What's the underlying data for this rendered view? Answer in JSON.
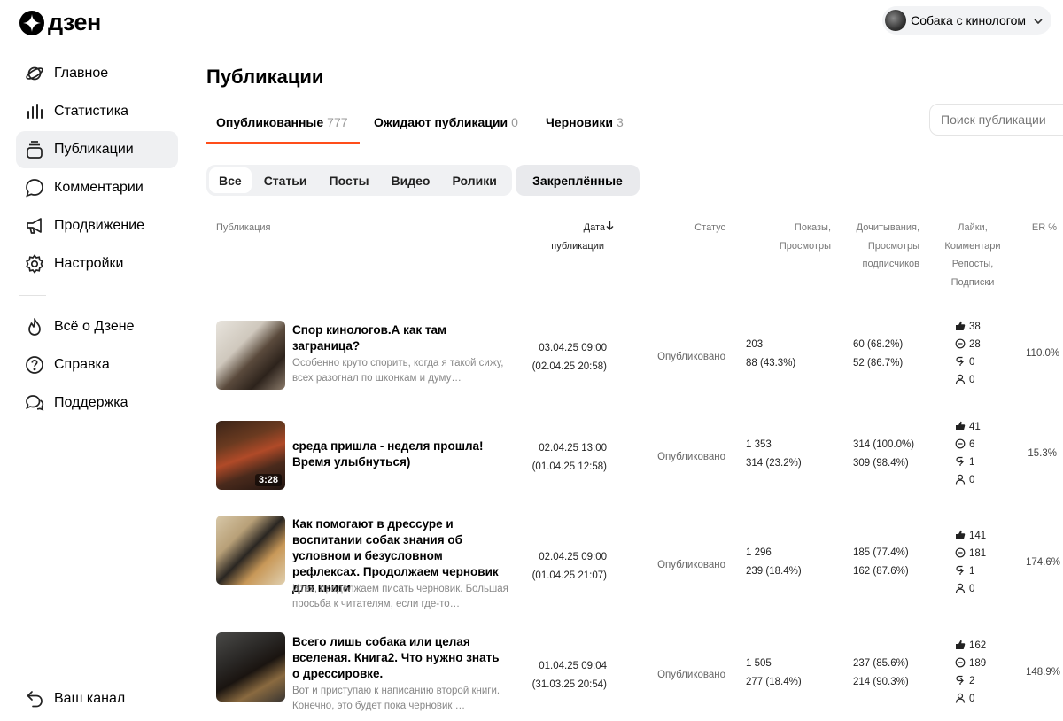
{
  "brand": {
    "name": "дзен"
  },
  "account": {
    "name": "Собака с кинологом"
  },
  "sidebar": {
    "items": [
      {
        "label": "Главное",
        "icon": "planet-icon"
      },
      {
        "label": "Статистика",
        "icon": "bar-chart-icon"
      },
      {
        "label": "Публикации",
        "icon": "publications-icon"
      },
      {
        "label": "Комментарии",
        "icon": "comment-icon"
      },
      {
        "label": "Продвижение",
        "icon": "megaphone-icon"
      },
      {
        "label": "Настройки",
        "icon": "gear-icon"
      }
    ],
    "secondary": [
      {
        "label": "Всё о Дзене",
        "icon": "flame-icon"
      },
      {
        "label": "Справка",
        "icon": "help-icon"
      },
      {
        "label": "Поддержка",
        "icon": "support-chat-icon"
      }
    ],
    "bottom": {
      "label": "Ваш канал",
      "icon": "back-arrow-icon"
    }
  },
  "page": {
    "title": "Публикации"
  },
  "tabs": [
    {
      "label": "Опубликованные",
      "count": "777"
    },
    {
      "label": "Ожидают публикации",
      "count": "0"
    },
    {
      "label": "Черновики",
      "count": "3"
    }
  ],
  "search": {
    "placeholder": "Поиск публикации"
  },
  "filters": [
    "Все",
    "Статьи",
    "Посты",
    "Видео",
    "Ролики"
  ],
  "pinned_label": "Закреплённые",
  "columns": {
    "publication": "Публикация",
    "date_1": "Дата",
    "date_2": "публикации",
    "status": "Статус",
    "shows_1": "Показы,",
    "shows_2": "Просмотры",
    "read_1": "Дочитывания,",
    "read_2": "Просмотры",
    "read_3": "подписчиков",
    "likes_1": "Лайки,",
    "likes_2": "Комментари",
    "likes_3": "Репосты,",
    "likes_4": "Подписки",
    "er": "ER %"
  },
  "rows": [
    {
      "title": "Спор кинологов.А как там заграница?",
      "desc": "Особенно круто спорить, когда я такой сижу, всех разогнал по шконкам и думу…",
      "date": "03.04.25 09:00",
      "date2": "(02.04.25 20:58)",
      "status": "Опубликовано",
      "shows": "203",
      "views": "88 (43.3%)",
      "reads": "60 (68.2%)",
      "sub_views": "52 (86.7%)",
      "likes": "38",
      "comments": "28",
      "reposts": "0",
      "subs": "0",
      "er": "110.0%",
      "duration": ""
    },
    {
      "title": "среда пришла - неделя прошла! Время улыбнуться)",
      "desc": "",
      "date": "02.04.25 13:00",
      "date2": "(01.04.25 12:58)",
      "status": "Опубликовано",
      "shows": "1 353",
      "views": "314 (23.2%)",
      "reads": "314 (100.0%)",
      "sub_views": "309 (98.4%)",
      "likes": "41",
      "comments": "6",
      "reposts": "1",
      "subs": "0",
      "er": "15.3%",
      "duration": "3:28"
    },
    {
      "title": "Как помогают в дрессуре и воспитании собак знания об условном и безусловном рефлексах. Продолжаем черновик для книги",
      "desc": "Итак, продолжаем писать черновик. Большая просьба к читателям, если где-то…",
      "date": "02.04.25 09:00",
      "date2": "(01.04.25 21:07)",
      "status": "Опубликовано",
      "shows": "1 296",
      "views": "239 (18.4%)",
      "reads": "185 (77.4%)",
      "sub_views": "162 (87.6%)",
      "likes": "141",
      "comments": "181",
      "reposts": "1",
      "subs": "0",
      "er": "174.6%",
      "duration": ""
    },
    {
      "title": "Всего лишь собака или целая вселеная. Книга2. Что нужно знать о дрессировке.",
      "desc": "Вот и приступаю к написанию второй книги. Конечно, это будет пока черновик …",
      "date": "01.04.25 09:04",
      "date2": "(31.03.25 20:54)",
      "status": "Опубликовано",
      "shows": "1 505",
      "views": "277 (18.4%)",
      "reads": "237 (85.6%)",
      "sub_views": "214 (90.3%)",
      "likes": "162",
      "comments": "189",
      "reposts": "2",
      "subs": "0",
      "er": "148.9%",
      "duration": ""
    }
  ]
}
